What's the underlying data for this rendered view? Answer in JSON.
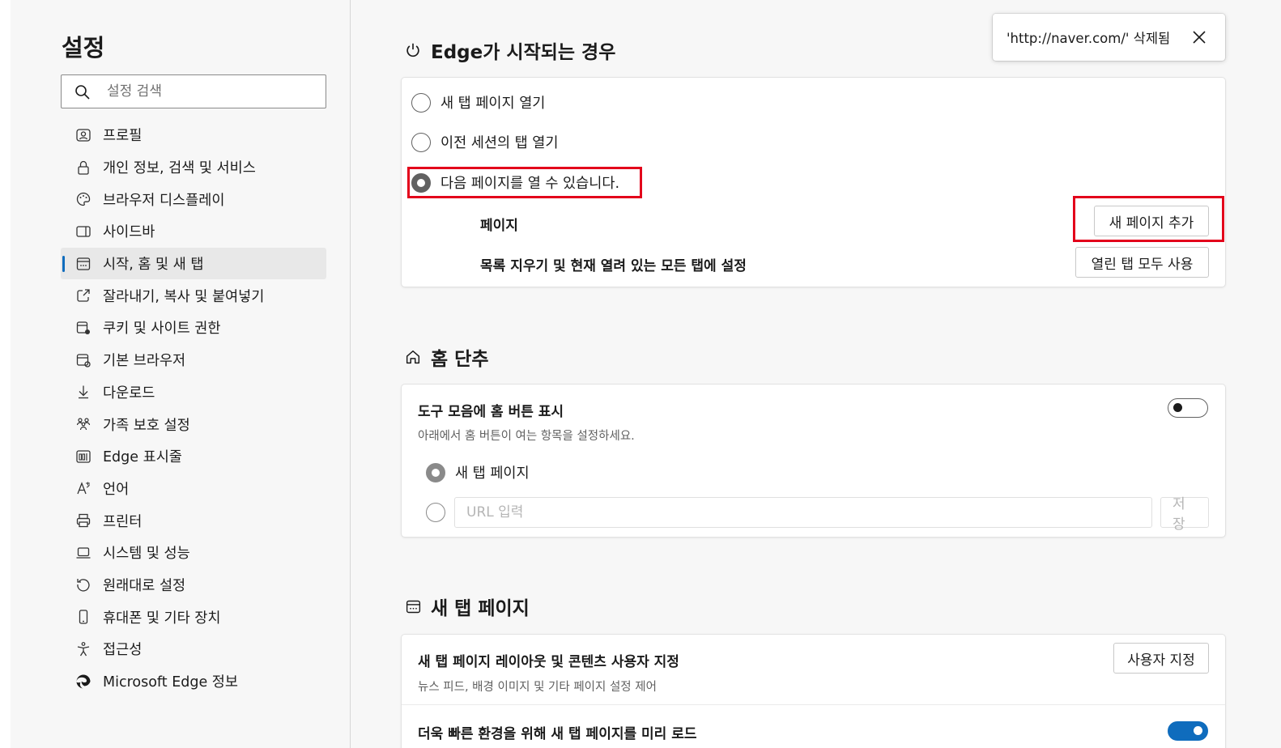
{
  "sidebar": {
    "title": "설정",
    "search_placeholder": "설정 검색",
    "items": [
      {
        "label": "프로필",
        "icon": "profile-icon"
      },
      {
        "label": "개인 정보, 검색 및 서비스",
        "icon": "lock-icon"
      },
      {
        "label": "브라우저 디스플레이",
        "icon": "palette-icon"
      },
      {
        "label": "사이드바",
        "icon": "sidebar-icon"
      },
      {
        "label": "시작, 홈 및 새 탭",
        "icon": "start-home-icon",
        "active": true
      },
      {
        "label": "잘라내기, 복사 및 붙여넣기",
        "icon": "share-icon"
      },
      {
        "label": "쿠키 및 사이트 권한",
        "icon": "cookie-permissions-icon"
      },
      {
        "label": "기본 브라우저",
        "icon": "default-browser-icon"
      },
      {
        "label": "다운로드",
        "icon": "download-icon"
      },
      {
        "label": "가족 보호 설정",
        "icon": "family-icon"
      },
      {
        "label": "Edge 표시줄",
        "icon": "edge-bar-icon"
      },
      {
        "label": "언어",
        "icon": "language-icon"
      },
      {
        "label": "프린터",
        "icon": "printer-icon"
      },
      {
        "label": "시스템 및 성능",
        "icon": "laptop-icon"
      },
      {
        "label": "원래대로 설정",
        "icon": "reset-icon"
      },
      {
        "label": "휴대폰 및 기타 장치",
        "icon": "phone-icon"
      },
      {
        "label": "접근성",
        "icon": "accessibility-icon"
      },
      {
        "label": "Microsoft Edge 정보",
        "icon": "edge-logo-icon"
      }
    ]
  },
  "startup": {
    "title": "Edge가 시작되는 경우",
    "options": [
      "새 탭 페이지 열기",
      "이전 세션의 탭 열기",
      "다음 페이지를 열 수 있습니다."
    ],
    "selected_index": 2,
    "pages_label": "페이지",
    "add_page_button": "새 페이지 추가",
    "clear_label": "목록 지우기 및 현재 열려 있는 모든 탭에 설정",
    "use_open_tabs_button": "열린 탭 모두 사용"
  },
  "home": {
    "title": "홈 단추",
    "show_label": "도구 모음에 홈 버튼 표시",
    "show_desc": "아래에서 홈 버튼이 여는 항목을 설정하세요.",
    "show_toggle_on": false,
    "option_newtab": "새 탭 페이지",
    "url_placeholder": "URL 입력",
    "save_button": "저장"
  },
  "newtab": {
    "title": "새 탭 페이지",
    "customize_label": "새 탭 페이지 레이아웃 및 콘텐츠 사용자 지정",
    "customize_desc": "뉴스 피드, 배경 이미지 및 기타 페이지 설정 제어",
    "customize_button": "사용자 지정",
    "preload_label": "더욱 빠른 환경을 위해 새 탭 페이지를 미리 로드",
    "preload_toggle_on": true
  },
  "toast": {
    "message": "'http://naver.com/' 삭제됨"
  },
  "colors": {
    "accent": "#0f6cbd",
    "highlight": "#e3001b"
  }
}
